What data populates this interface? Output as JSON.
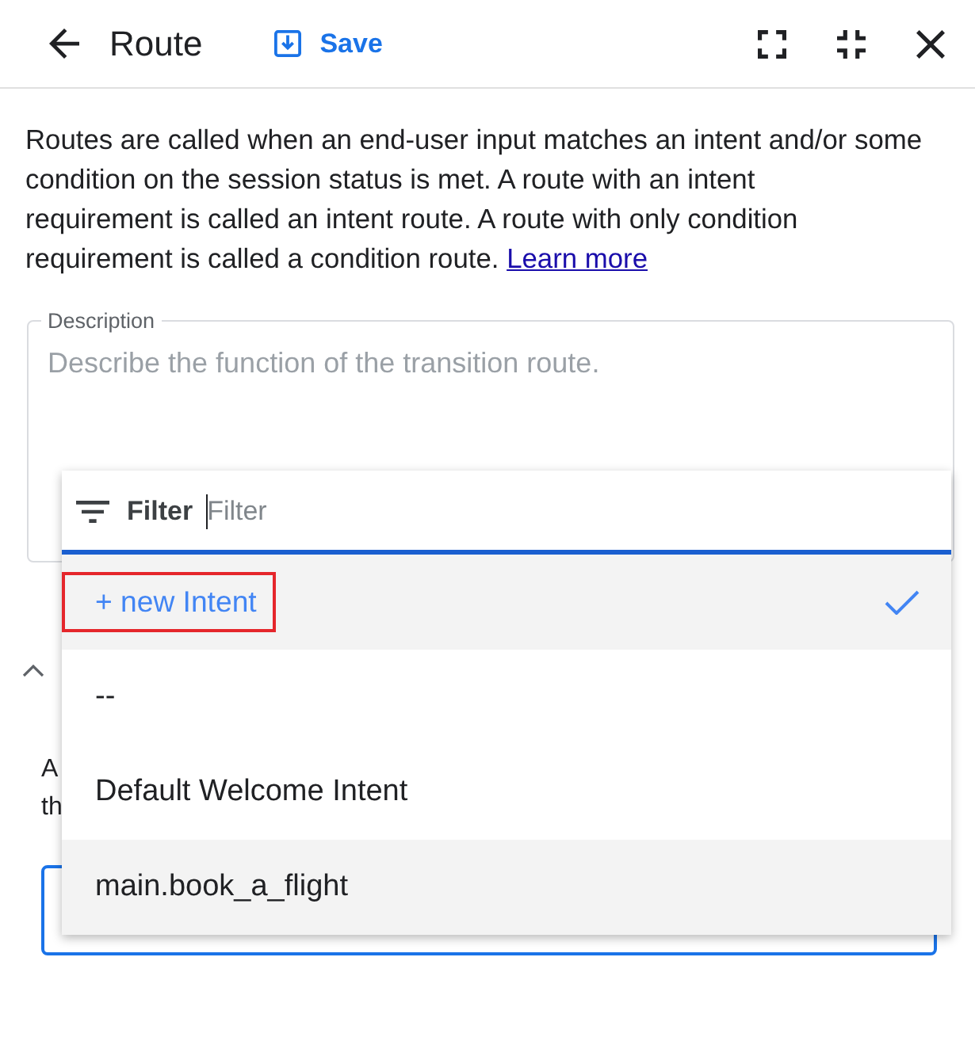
{
  "header": {
    "title": "Route",
    "save_label": "Save"
  },
  "intro": {
    "lines": [
      "Routes are called when an end-user input matches an intent and/or some",
      "condition on the session status is met. A route with an intent",
      "requirement is called an intent route. A route with only condition",
      "requirement is called a condition route."
    ],
    "link": "Learn more"
  },
  "description_field": {
    "label": "Description",
    "placeholder": "Describe the function of the transition route."
  },
  "intent_section": {
    "expanded": true,
    "text_lines": [
      "A",
      "th"
    ],
    "field": {
      "focused": true
    }
  },
  "intent_dropdown": {
    "filter_label": "Filter",
    "filter_placeholder": "Filter",
    "options": [
      {
        "label": "+ new Intent",
        "kind": "action",
        "selected": true,
        "highlighted": true,
        "marked": true
      },
      {
        "label": "--",
        "kind": "intent",
        "selected": false,
        "highlighted": false,
        "marked": false
      },
      {
        "label": "Default Welcome Intent",
        "kind": "intent",
        "selected": false,
        "highlighted": false,
        "marked": false
      },
      {
        "label": "main.book_a_flight",
        "kind": "intent",
        "selected": false,
        "highlighted": true,
        "marked": false
      }
    ]
  }
}
